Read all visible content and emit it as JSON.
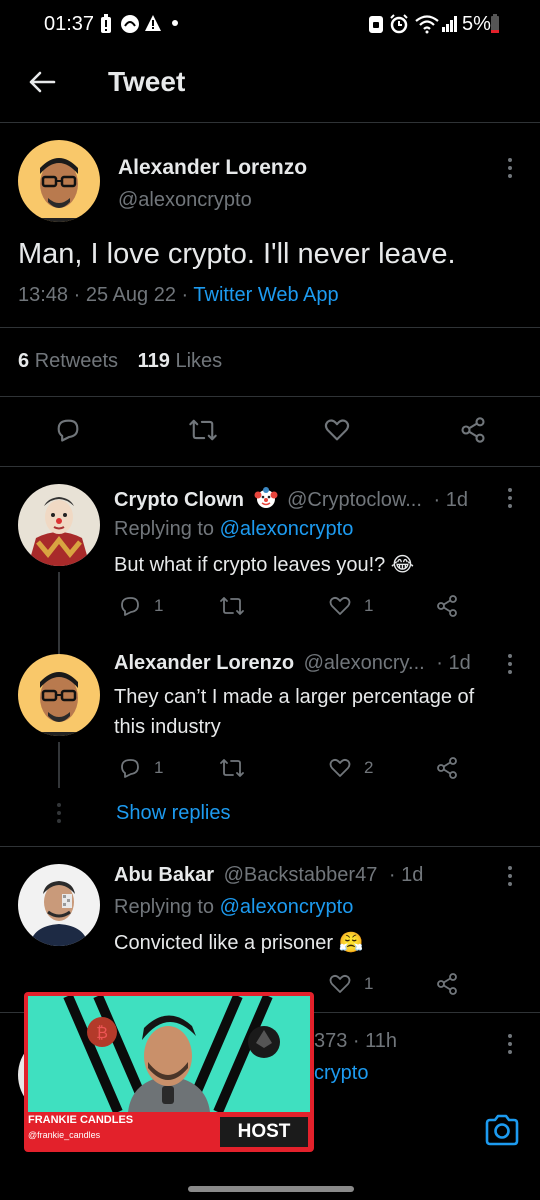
{
  "status_bar": {
    "time": "01:37",
    "battery": "5%"
  },
  "header": {
    "title": "Tweet"
  },
  "main_tweet": {
    "author_name": "Alexander Lorenzo",
    "handle": "@alexoncrypto",
    "text": "Man, I love crypto. I'll never leave.",
    "time": "13:48",
    "sep1": "·",
    "date": "25 Aug 22",
    "sep2": "·",
    "source": "Twitter Web App",
    "retweets_count": "6",
    "retweets_label": "Retweets",
    "likes_count": "119",
    "likes_label": "Likes"
  },
  "replies": [
    {
      "name": "Crypto Clown",
      "handle": "@Cryptoclow...",
      "age": "· 1d",
      "replying_prefix": "Replying to",
      "replying_handle": "@alexoncrypto",
      "text": "But what if crypto leaves you!? 😂",
      "reply_count": "1",
      "like_count": "1"
    },
    {
      "name": "Alexander Lorenzo",
      "handle": "@alexoncry...",
      "age": "· 1d",
      "text_line1": "They can’t I made a larger percentage of",
      "text_line2": "this industry",
      "reply_count": "1",
      "like_count": "2"
    },
    {
      "name": "Abu Bakar",
      "handle": "@Backstabber47",
      "age": "· 1d",
      "replying_prefix": "Replying to",
      "replying_handle": "@alexoncrypto",
      "text": "Convicted like a prisoner 😤",
      "like_count": "1"
    },
    {
      "partial_handle": "373 · 11h",
      "partial_reply": "crypto"
    }
  ],
  "show_replies": "Show replies",
  "overlay": {
    "host_name": "FRANKIE CANDLES",
    "host_handle": "@frankie_candles",
    "host_badge": "HOST"
  },
  "colors": {
    "accent": "#1d9bf0",
    "avatar_bg": "#f9c86a",
    "overlay_red": "#e3212b"
  },
  "icons": [
    "back-arrow-icon",
    "reply-icon",
    "retweet-icon",
    "like-icon",
    "share-icon",
    "more-icon",
    "camera-icon"
  ]
}
